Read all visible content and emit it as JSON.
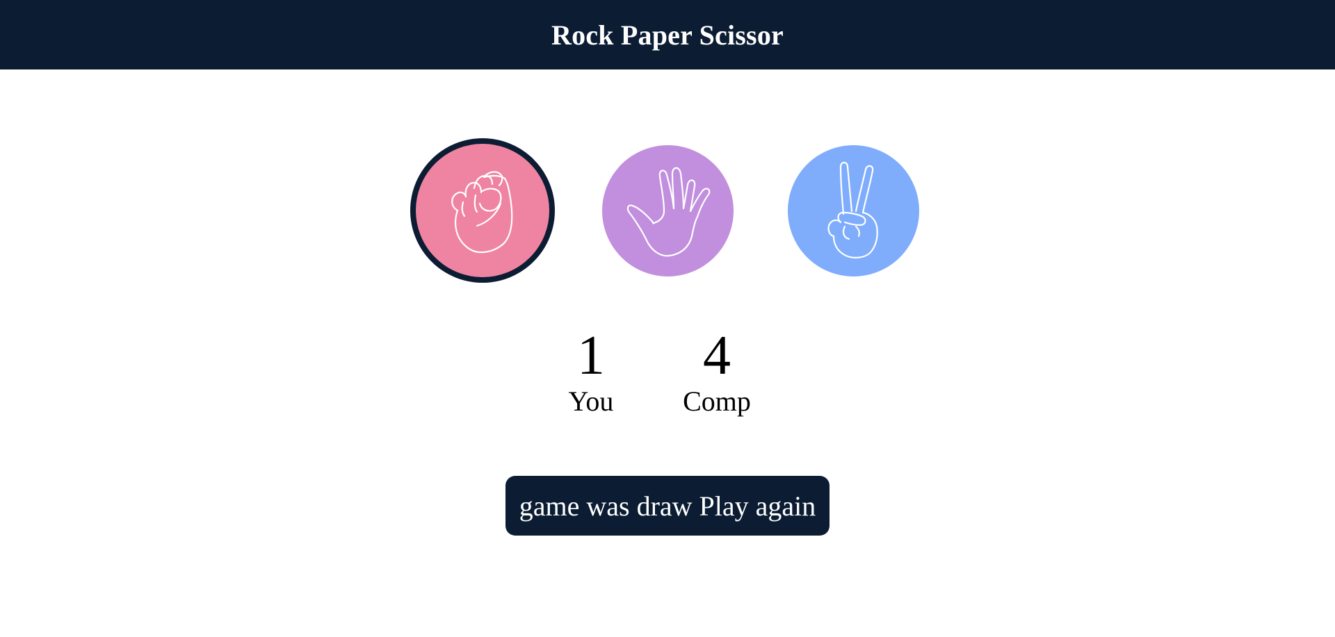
{
  "header": {
    "title": "Rock Paper Scissor"
  },
  "choices": [
    {
      "id": "rock",
      "icon": "fist-icon",
      "color": "#ef84a2",
      "selected": true
    },
    {
      "id": "paper",
      "icon": "open-hand-icon",
      "color": "#c18fdd",
      "selected": false
    },
    {
      "id": "scissors",
      "icon": "peace-hand-icon",
      "color": "#7fadfb",
      "selected": false
    }
  ],
  "scoreboard": {
    "you": {
      "score": "1",
      "label": "You"
    },
    "comp": {
      "score": "4",
      "label": "Comp"
    }
  },
  "message": {
    "text": "game was draw Play again"
  },
  "colors": {
    "header_bg": "#0b1c33",
    "selected_ring": "#0b1c33",
    "button_bg": "#0b1c33"
  }
}
